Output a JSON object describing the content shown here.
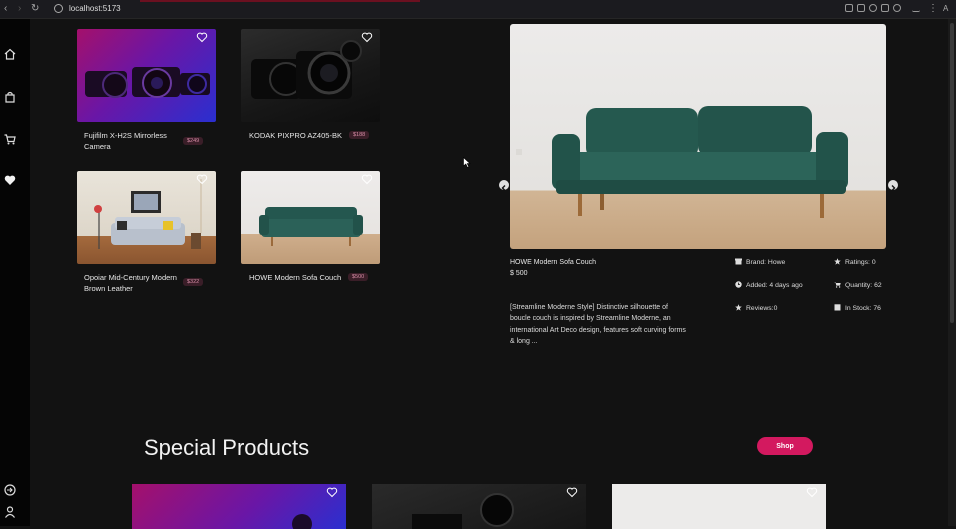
{
  "browser": {
    "url": "localhost:5173",
    "nav_back": "‹",
    "nav_forward": "›",
    "nav_reload": "↻",
    "menu_label": "⋮",
    "profile_label": "A"
  },
  "sidebar": {
    "items": [
      {
        "icon": "home-icon"
      },
      {
        "icon": "shopping-bag-icon"
      },
      {
        "icon": "cart-icon"
      },
      {
        "icon": "heart-icon"
      },
      {
        "icon": "logout-icon"
      },
      {
        "icon": "user-icon"
      }
    ]
  },
  "products": [
    {
      "title": "Fujifilm X-H2S Mirrorless Camera",
      "price": "$249"
    },
    {
      "title": "KODAK PIXPRO AZ405-BK",
      "price": "$188"
    },
    {
      "title": "Opoiar Mid-Century Modern Brown Leather",
      "price": "$322"
    },
    {
      "title": "HOWE Modern Sofa Couch",
      "price": "$500"
    }
  ],
  "detail": {
    "name": "HOWE Modern Sofa Couch",
    "price": "$ 500",
    "brand": "Brand: Howe",
    "added": "Added: 4 days ago",
    "reviews": "Reviews:0",
    "ratings": "Ratings: 0",
    "quantity": "Quantity: 62",
    "in_stock": "In Stock: 76",
    "description": "[Streamline Moderne Style] Distinctive silhouette of boucle couch is inspired by Streamline Moderne, an international Art Deco design, features soft curving forms & long ..."
  },
  "special": {
    "title": "Special Products",
    "shop_label": "Shop"
  },
  "colors": {
    "background": "#121212",
    "accent": "#d3195f",
    "badge_bg": "#3a1e28",
    "badge_text": "#d58ba5"
  }
}
